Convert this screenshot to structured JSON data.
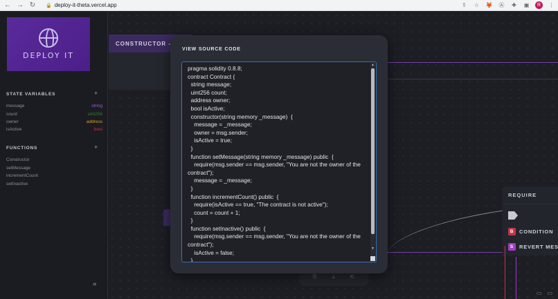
{
  "browser": {
    "url": "deploy-it-theta.vercel.app",
    "avatar_letter": "R"
  },
  "sidebar": {
    "logo_text": "DEPLOY IT",
    "state_title": "STATE VARIABLES",
    "variables": [
      {
        "name": "message",
        "type": "string",
        "color": "#a25bd6"
      },
      {
        "name": "count",
        "type": "uint256",
        "color": "#3f7b3a"
      },
      {
        "name": "owner",
        "type": "address",
        "color": "#d7a429"
      },
      {
        "name": "isActive",
        "type": "bool",
        "color": "#c8324a"
      }
    ],
    "functions_title": "FUNCTIONS",
    "functions": [
      "Constructor",
      "setMessage",
      "incrementCount",
      "setInactive"
    ],
    "collapse_icon": "double-chevron-left-icon"
  },
  "canvas": {
    "constructor_node_title": "CONSTRUCTOR - S",
    "require_node": {
      "title": "REQUIRE",
      "rows": [
        {
          "badge": "B",
          "label": "CONDITION",
          "color": "#c8324a"
        },
        {
          "badge": "S",
          "label": "REVERT MESS",
          "color": "#a23fc0"
        }
      ]
    }
  },
  "modal": {
    "title": "VIEW SOURCE CODE",
    "code": "pragma solidity 0.8.8;\ncontract Contract {\n  string message;\n  uint256 count;\n  address owner;\n  bool isActive;\n  constructor(string memory _message)  {\n    message = _message;\n    owner = msg.sender;\n    isActive = true;\n  }\n  function setMessage(string memory _message) public  {\n    require(msg.sender == msg.sender, \"You are not the owner of the contract\");\n    message = _message;\n  }\n  function incrementCount() public  {\n    require(isActive == true, \"The contract is not active\");\n    count = count + 1;\n  }\n  function setInactive() public  {\n    require(msg.sender == msg.sender, \"You are not the owner of the contract\");\n    isActive = false;\n  }"
  }
}
